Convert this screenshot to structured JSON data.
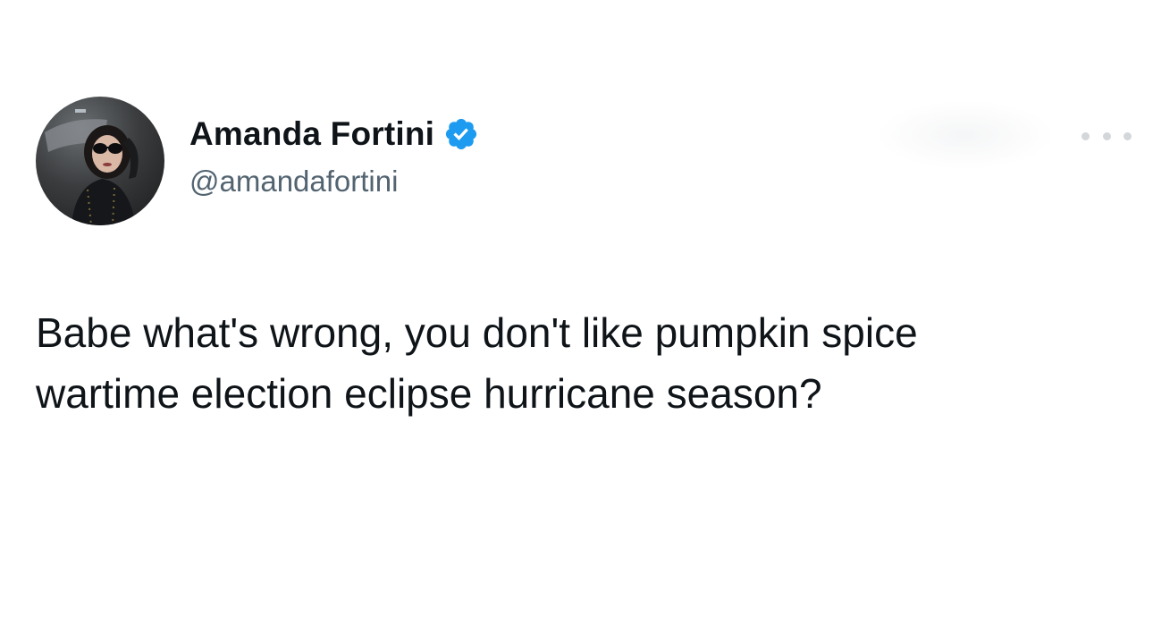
{
  "author": {
    "display_name": "Amanda Fortini",
    "handle": "@amandafortini",
    "verified": true,
    "verified_color": "#1d9bf0",
    "avatar_icon": "avatar-photo-icon"
  },
  "tweet": {
    "lines": [
      "Babe what's wrong, you don't like pumpkin spice",
      "wartime election eclipse hurricane season?"
    ]
  },
  "actions": {
    "more_icon": "more-horizontal-icon"
  },
  "colors": {
    "text": "#0f1419",
    "secondary": "#536471",
    "background": "#ffffff"
  }
}
